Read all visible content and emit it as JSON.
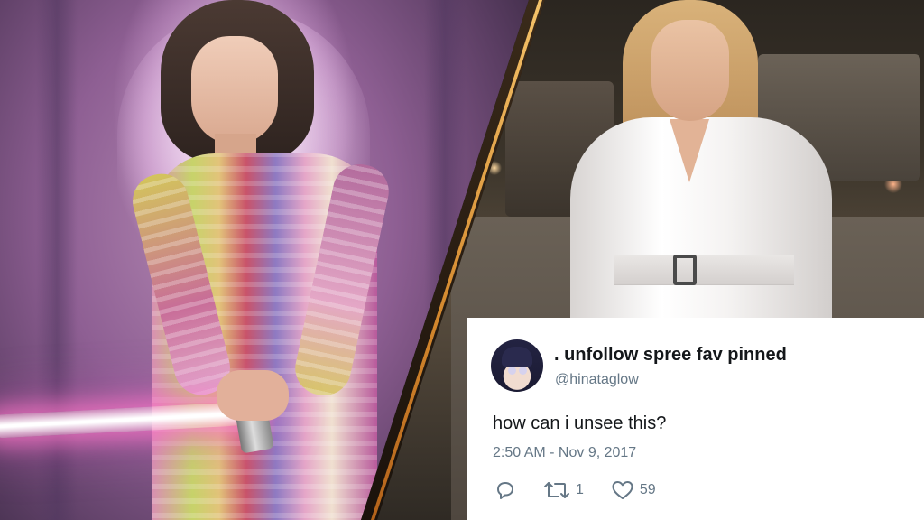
{
  "tweet": {
    "display_name": ". unfollow spree fav pinned",
    "handle": "@hinataglow",
    "text": "how can i unsee this?",
    "timestamp": "2:50 AM - Nov 9, 2017",
    "retweet_count": "1",
    "like_count": "59",
    "icons": {
      "reply": "reply-icon",
      "retweet": "retweet-icon",
      "like": "heart-icon"
    }
  },
  "colors": {
    "tweet_text": "#14171a",
    "tweet_secondary": "#657786",
    "divider_gold": "#d4892e",
    "left_scene_purple": "#8e5f93",
    "saber_glow": "#ff78c8"
  }
}
